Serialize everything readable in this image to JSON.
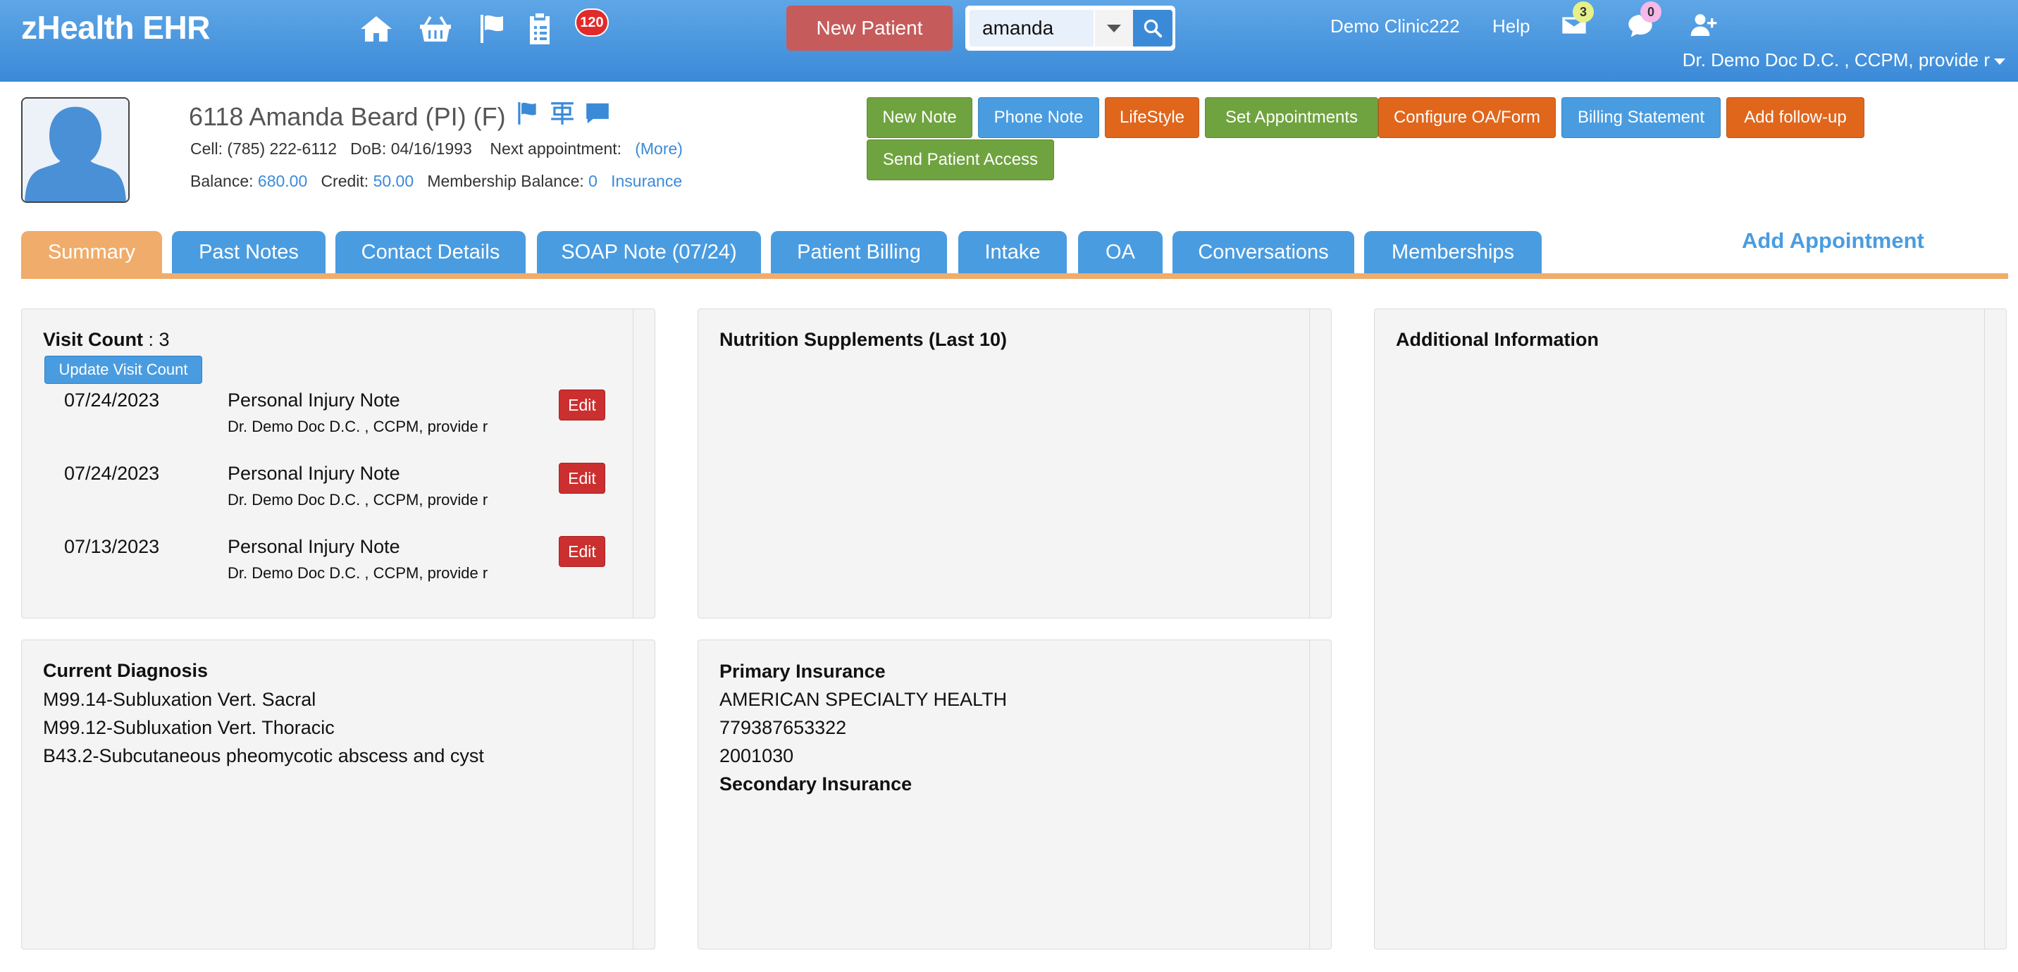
{
  "app": {
    "title": "zHealth EHR"
  },
  "topbar": {
    "notification_count": "120",
    "new_patient_label": "New Patient",
    "search": {
      "value": "amanda",
      "placeholder": ""
    },
    "clinic": "Demo Clinic222",
    "help": "Help",
    "mail_count": "3",
    "chat_count": "0",
    "user": "Dr. Demo Doc D.C. , CCPM, provide r"
  },
  "patient": {
    "name": "6118 Amanda Beard",
    "tags": "(PI) (F)",
    "cell_label": "Cell:",
    "cell": "(785) 222-6112",
    "dob_label": "DoB:",
    "dob": "04/16/1993",
    "next_appt_label": "Next appointment:",
    "more_link": "(More)",
    "balance_label": "Balance:",
    "balance": "680.00",
    "credit_label": "Credit:",
    "credit": "50.00",
    "membership_label": "Membership Balance:",
    "membership": "0",
    "insurance_link": "Insurance"
  },
  "actions": [
    {
      "label": "New Note",
      "color": "#6fa33f"
    },
    {
      "label": "Phone Note",
      "color": "#4a9ce0"
    },
    {
      "label": "LifeStyle",
      "color": "#e0661c"
    },
    {
      "label": "Set Appointments",
      "color": "#6fa33f"
    },
    {
      "label": "Configure OA/Form",
      "color": "#e0661c"
    },
    {
      "label": "Billing Statement",
      "color": "#4a9ce0"
    },
    {
      "label": "Add follow-up",
      "color": "#e0661c"
    },
    {
      "label": "Send Patient Access",
      "color": "#6fa33f"
    }
  ],
  "tabs": [
    {
      "label": "Summary",
      "active": true
    },
    {
      "label": "Past Notes"
    },
    {
      "label": "Contact Details"
    },
    {
      "label": "SOAP Note (07/24)"
    },
    {
      "label": "Patient Billing"
    },
    {
      "label": "Intake"
    },
    {
      "label": "OA"
    },
    {
      "label": "Conversations"
    },
    {
      "label": "Memberships"
    }
  ],
  "add_appointment": "Add Appointment",
  "visits": {
    "count_label": "Visit Count",
    "count": "3",
    "update_label": "Update Visit Count",
    "edit_label": "Edit",
    "items": [
      {
        "date": "07/24/2023",
        "title": "Personal Injury Note",
        "doctor": "Dr. Demo Doc D.C. , CCPM, provide r"
      },
      {
        "date": "07/24/2023",
        "title": "Personal Injury Note",
        "doctor": "Dr. Demo Doc D.C. , CCPM, provide r"
      },
      {
        "date": "07/13/2023",
        "title": "Personal Injury Note",
        "doctor": "Dr. Demo Doc D.C. , CCPM, provide r"
      }
    ]
  },
  "nutrition": {
    "title": "Nutrition Supplements (Last 10)"
  },
  "additional": {
    "title": "Additional Information"
  },
  "diagnosis": {
    "title": "Current Diagnosis",
    "items": [
      "M99.14-Subluxation Vert. Sacral",
      "M99.12-Subluxation Vert. Thoracic",
      "B43.2-Subcutaneous pheomycotic abscess and cyst"
    ]
  },
  "insurance": {
    "primary_title": "Primary Insurance",
    "primary_name": "AMERICAN SPECIALTY HEALTH",
    "primary_id": "779387653322",
    "primary_group": "2001030",
    "secondary_title": "Secondary Insurance"
  }
}
